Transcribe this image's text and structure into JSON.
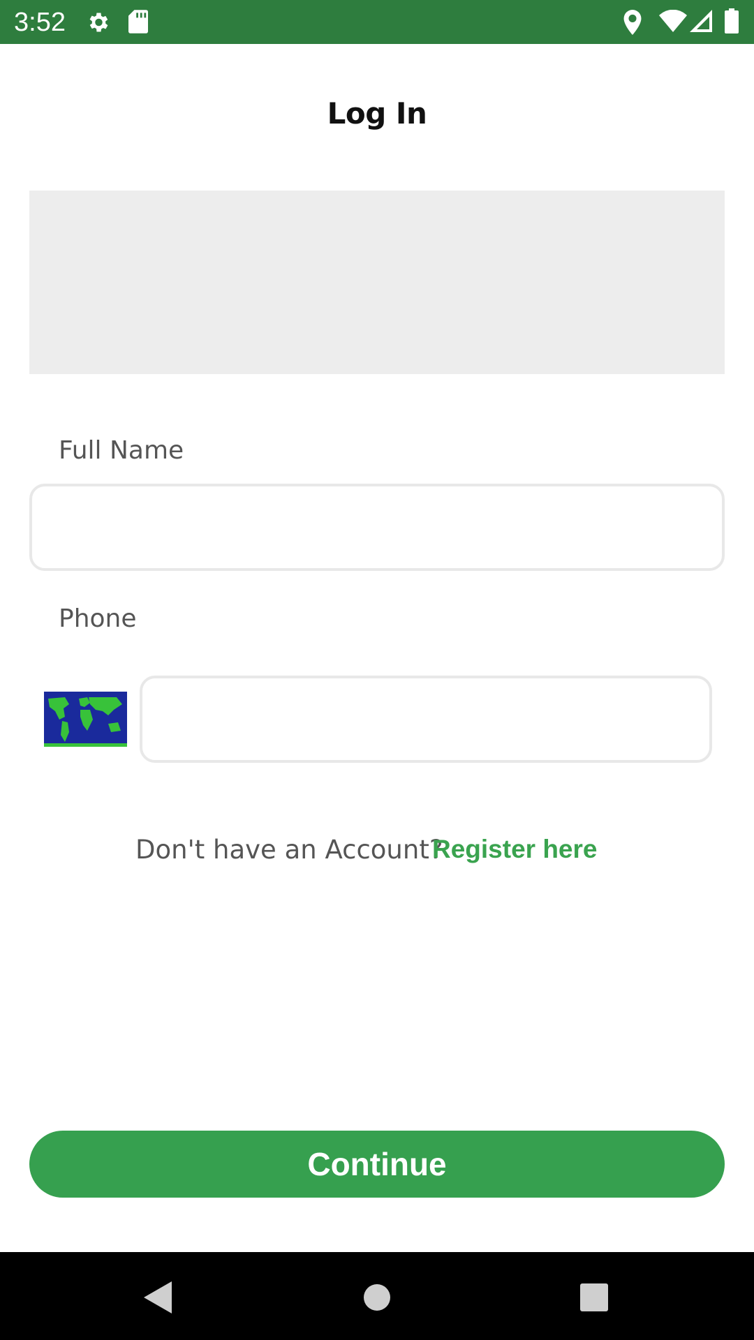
{
  "status_bar": {
    "time": "3:52",
    "icons": [
      "gear-icon",
      "sd-card-icon",
      "location-icon",
      "wifi-icon",
      "signal-icon",
      "battery-icon"
    ],
    "background": "#2e7d3e"
  },
  "page": {
    "title": "Log In"
  },
  "form": {
    "full_name_label": "Full Name",
    "full_name_value": "",
    "phone_label": "Phone",
    "phone_value": "",
    "country_flag_icon": "world-map-flag-icon"
  },
  "register": {
    "prompt": "Don't have an Account?",
    "link": "Register here",
    "link_color": "#3aa34f"
  },
  "actions": {
    "continue_label": "Continue",
    "accent": "#36a04f"
  },
  "nav_bar": {
    "icons": [
      "back-icon",
      "home-icon",
      "recents-icon"
    ]
  }
}
